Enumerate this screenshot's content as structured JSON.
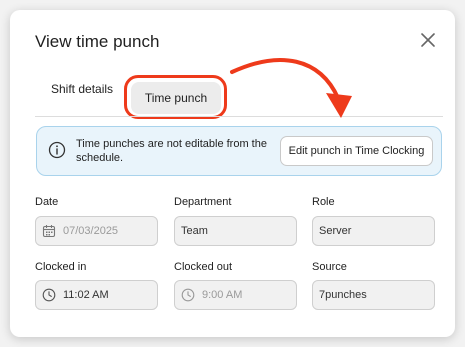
{
  "modal": {
    "title": "View time punch",
    "close_icon": "close-icon"
  },
  "tabs": [
    {
      "label": "Shift details",
      "active": false
    },
    {
      "label": "Time punch",
      "active": true
    }
  ],
  "banner": {
    "text": "Time punches are not editable from the schedule.",
    "button_label": "Edit punch in Time Clocking",
    "icon": "info-icon"
  },
  "fields": {
    "date": {
      "label": "Date",
      "value": "07/03/2025",
      "icon": "calendar-icon",
      "disabled": true
    },
    "department": {
      "label": "Department",
      "value": "Team"
    },
    "role": {
      "label": "Role",
      "value": "Server"
    },
    "clocked_in": {
      "label": "Clocked in",
      "value": "11:02 AM",
      "icon": "clock-icon"
    },
    "clocked_out": {
      "label": "Clocked out",
      "value": "9:00 AM",
      "icon": "clock-icon",
      "disabled": true
    },
    "source": {
      "label": "Source",
      "value": "7punches"
    }
  },
  "colors": {
    "highlight": "#ee3a1b",
    "banner_bg": "#e9f4fb",
    "banner_border": "#a9d3ec"
  }
}
